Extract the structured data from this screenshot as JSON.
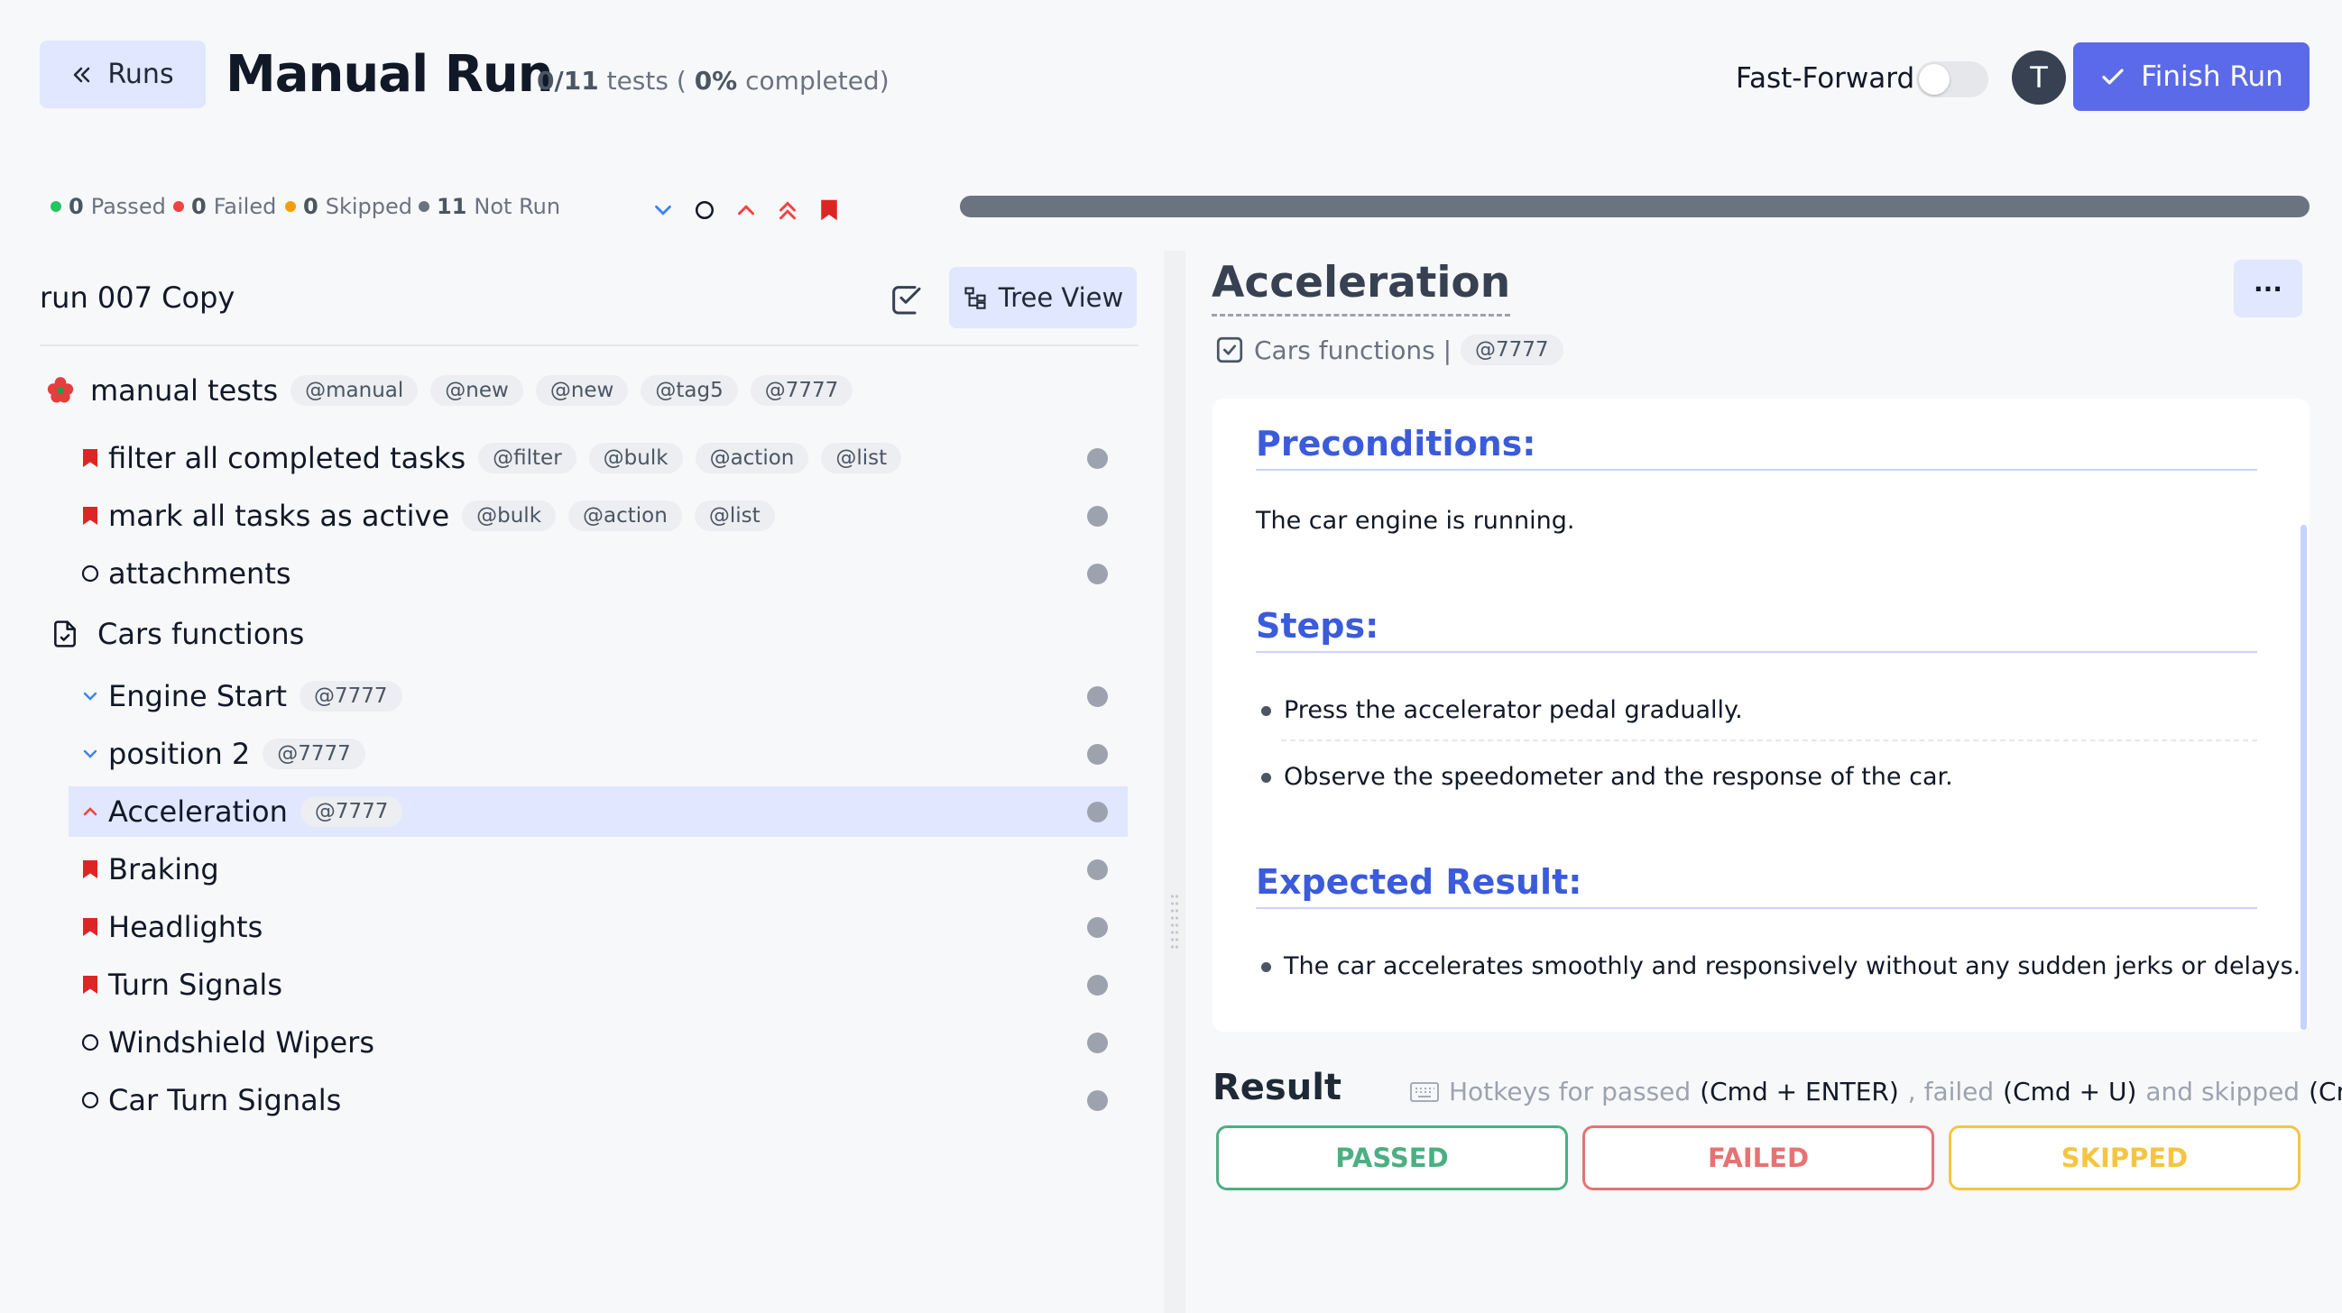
{
  "header": {
    "back_label": "Runs",
    "title": "Manual Run",
    "tests_done": "0/11",
    "tests_word": "tests (",
    "percent": "0%",
    "percent_suffix": "completed)",
    "fast_forward_label": "Fast-Forward",
    "fast_forward_on": false,
    "avatar_letter": "T",
    "finish_label": "Finish Run"
  },
  "status": {
    "passed_count": "0",
    "passed_label": "Passed",
    "failed_count": "0",
    "failed_label": "Failed",
    "skipped_count": "0",
    "skipped_label": "Skipped",
    "notrun_count": "11",
    "notrun_label": "Not Run",
    "progress": 0,
    "colors": {
      "passed": "#22c55e",
      "failed": "#ef4444",
      "skipped": "#f59e0b",
      "notrun": "#6b7280"
    }
  },
  "left": {
    "run_name": "run 007 Copy",
    "tree_view_label": "Tree View",
    "suite1": {
      "title": "manual tests",
      "tags": [
        "@manual",
        "@new",
        "@new",
        "@tag5",
        "@7777"
      ]
    },
    "suite1_tests": [
      {
        "title": "filter all completed tasks",
        "tags": [
          "@filter",
          "@bulk",
          "@action",
          "@list"
        ],
        "icon": "bookmark-icon"
      },
      {
        "title": "mark all tasks as active",
        "tags": [
          "@bulk",
          "@action",
          "@list"
        ],
        "icon": "bookmark-icon"
      },
      {
        "title": "attachments",
        "tags": [],
        "icon": "circle-icon"
      }
    ],
    "suite2": {
      "title": "Cars functions"
    },
    "suite2_tests": [
      {
        "title": "Engine Start",
        "tags": [
          "@7777"
        ],
        "icon": "chevron-down-icon"
      },
      {
        "title": "position 2",
        "tags": [
          "@7777"
        ],
        "icon": "chevron-down-icon"
      },
      {
        "title": "Acceleration",
        "tags": [
          "@7777"
        ],
        "icon": "chevron-up-icon"
      },
      {
        "title": "Braking",
        "tags": [],
        "icon": "bookmark-icon"
      },
      {
        "title": "Headlights",
        "tags": [],
        "icon": "bookmark-icon"
      },
      {
        "title": "Turn Signals",
        "tags": [],
        "icon": "bookmark-icon"
      },
      {
        "title": "Windshield Wipers",
        "tags": [],
        "icon": "circle-icon"
      },
      {
        "title": "Car Turn Signals",
        "tags": [],
        "icon": "circle-icon"
      }
    ]
  },
  "detail": {
    "title": "Acceleration",
    "suite": "Cars functions |",
    "tag": "@7777",
    "more_label": "···",
    "preconditions_heading": "Preconditions:",
    "preconditions_text": "The car engine is running.",
    "steps_heading": "Steps:",
    "steps": [
      "Press the accelerator pedal gradually.",
      "Observe the speedometer and the response of the car."
    ],
    "expected_heading": "Expected Result:",
    "expected": [
      "The car accelerates smoothly and responsively without any sudden jerks or delays."
    ],
    "result_label": "Result",
    "hotkeys": {
      "prefix": "Hotkeys for passed",
      "passed_key": "(Cmd + ENTER)",
      "mid1": ", failed",
      "failed_key": "(Cmd + U)",
      "mid2": "and skipped",
      "skipped_key": "(Cmd + I)"
    },
    "buttons": {
      "passed": "PASSED",
      "failed": "FAILED",
      "skipped": "SKIPPED",
      "passed_color": "#4caf82",
      "failed_color": "#e57373",
      "skipped_color": "#f5c542"
    }
  }
}
